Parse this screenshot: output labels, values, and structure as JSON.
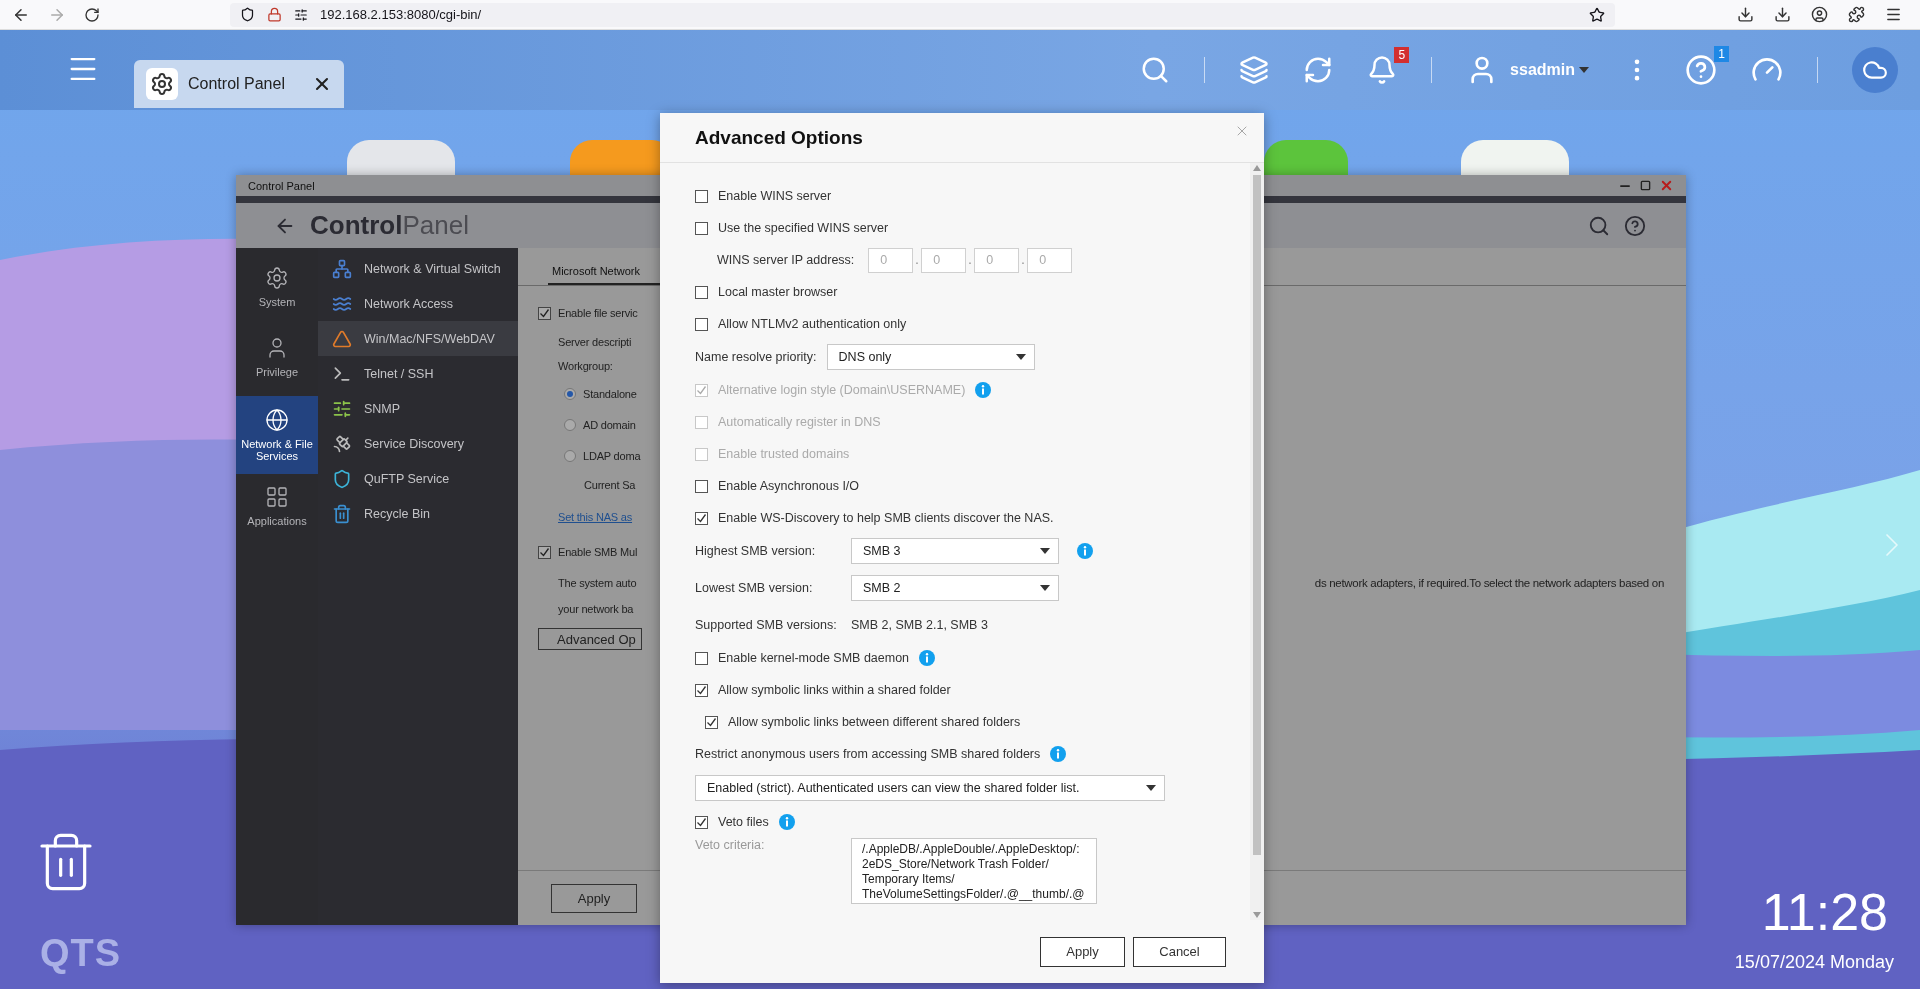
{
  "browser": {
    "url": "192.168.2.153:8080/cgi-bin/"
  },
  "topbar": {
    "tab": {
      "label": "Control Panel"
    },
    "notification_count": "5",
    "user": "ssadmin",
    "info_count": "1"
  },
  "desktop": {
    "logo": "QTS",
    "time": "11:28",
    "date": "15/07/2024 Monday"
  },
  "control_panel": {
    "title": "Control Panel",
    "header": "**Control**Panel",
    "categories": [
      {
        "label": "System",
        "selected": false
      },
      {
        "label": "Privilege",
        "selected": false
      },
      {
        "label": "Network & File Services",
        "selected": true
      },
      {
        "label": "Applications",
        "selected": false
      }
    ],
    "menu": [
      {
        "label": "Network & Virtual Switch",
        "selected": false
      },
      {
        "label": "Network Access",
        "selected": false
      },
      {
        "label": "Win/Mac/NFS/WebDAV",
        "selected": true
      },
      {
        "label": "Telnet / SSH",
        "selected": false
      },
      {
        "label": "SNMP",
        "selected": false
      },
      {
        "label": "Service Discovery",
        "selected": false
      },
      {
        "label": "QuFTP Service",
        "selected": false
      },
      {
        "label": "Recycle Bin",
        "selected": false
      }
    ],
    "tabs": [
      {
        "label": "Microsoft Network",
        "selected": true
      }
    ],
    "content": [
      {
        "kind": "check",
        "label": "Enable file servic",
        "checked": true
      },
      {
        "kind": "text",
        "text": "Server descripti"
      },
      {
        "kind": "text",
        "text": "Workgroup:"
      },
      {
        "kind": "radio",
        "label": "Standalone",
        "selected": true
      },
      {
        "kind": "radio",
        "label": "AD domain",
        "selected": false
      },
      {
        "kind": "radio",
        "label": "LDAP doma",
        "selected": false
      },
      {
        "kind": "note",
        "text": "Current Sa"
      },
      {
        "kind": "link",
        "text": "Set this NAS as"
      },
      {
        "kind": "check",
        "label": "Enable SMB Mul",
        "checked": true
      },
      {
        "kind": "text",
        "text": "The system auto",
        "tail": "ds network adapters, if required.To select the network adapters based on"
      },
      {
        "kind": "text",
        "text": "your network ba"
      },
      {
        "kind": "button",
        "label": "Advanced Op"
      }
    ],
    "apply": "Apply"
  },
  "dialog": {
    "title": "Advanced Options",
    "rows": [
      {
        "kind": "check",
        "label": "Enable WINS server",
        "checked": false,
        "disabled": false
      },
      {
        "kind": "check",
        "label": "Use the specified WINS server",
        "checked": false,
        "disabled": false
      },
      {
        "kind": "ip",
        "label": "WINS server IP address:",
        "octets": [
          "0",
          "0",
          "0",
          "0"
        ],
        "separator": "."
      },
      {
        "kind": "check",
        "label": "Local master browser",
        "checked": false,
        "disabled": false
      },
      {
        "kind": "check",
        "label": "Allow NTLMv2 authentication only",
        "checked": false,
        "disabled": false
      },
      {
        "kind": "inline-select",
        "label": "Name resolve priority:",
        "value": "DNS only"
      },
      {
        "kind": "check",
        "label": "Alternative login style (Domain\\USERNAME)",
        "checked": true,
        "disabled": true,
        "info": true
      },
      {
        "kind": "check",
        "label": "Automatically register in DNS",
        "checked": false,
        "disabled": true
      },
      {
        "kind": "check",
        "label": "Enable trusted domains",
        "checked": false,
        "disabled": true
      },
      {
        "kind": "check",
        "label": "Enable Asynchronous I/O",
        "checked": false,
        "disabled": false
      },
      {
        "kind": "check",
        "label": "Enable WS-Discovery to help SMB clients discover the NAS.",
        "checked": true,
        "disabled": false
      },
      {
        "kind": "select",
        "label": "Highest SMB version:",
        "value": "SMB 3",
        "info": true
      },
      {
        "kind": "select",
        "label": "Lowest SMB version:",
        "value": "SMB 2"
      },
      {
        "kind": "pair",
        "label": "Supported SMB versions:",
        "value": "SMB 2, SMB 2.1, SMB 3"
      },
      {
        "kind": "check",
        "label": "Enable kernel-mode SMB daemon",
        "checked": false,
        "disabled": false,
        "info": true
      },
      {
        "kind": "check",
        "label": "Allow symbolic links within a shared folder",
        "checked": true,
        "disabled": false
      },
      {
        "kind": "subcheck",
        "label": "Allow symbolic links between different shared folders",
        "checked": true,
        "disabled": false
      },
      {
        "kind": "heading",
        "label": "Restrict anonymous users from accessing SMB shared folders",
        "info": true
      },
      {
        "kind": "wideselect",
        "value": "Enabled (strict). Authenticated users can view the shared folder list."
      },
      {
        "kind": "check",
        "label": "Veto files",
        "checked": true,
        "disabled": false,
        "info": true
      },
      {
        "kind": "textarea",
        "label": "Veto criteria:",
        "lines": [
          "/.AppleDB/.AppleDouble/.AppleDesktop/:",
          "2eDS_Store/Network Trash Folder/",
          "Temporary Items/",
          "TheVolumeSettingsFolder/.@__thumb/.@"
        ]
      }
    ],
    "buttons": [
      "Apply",
      "Cancel"
    ]
  }
}
